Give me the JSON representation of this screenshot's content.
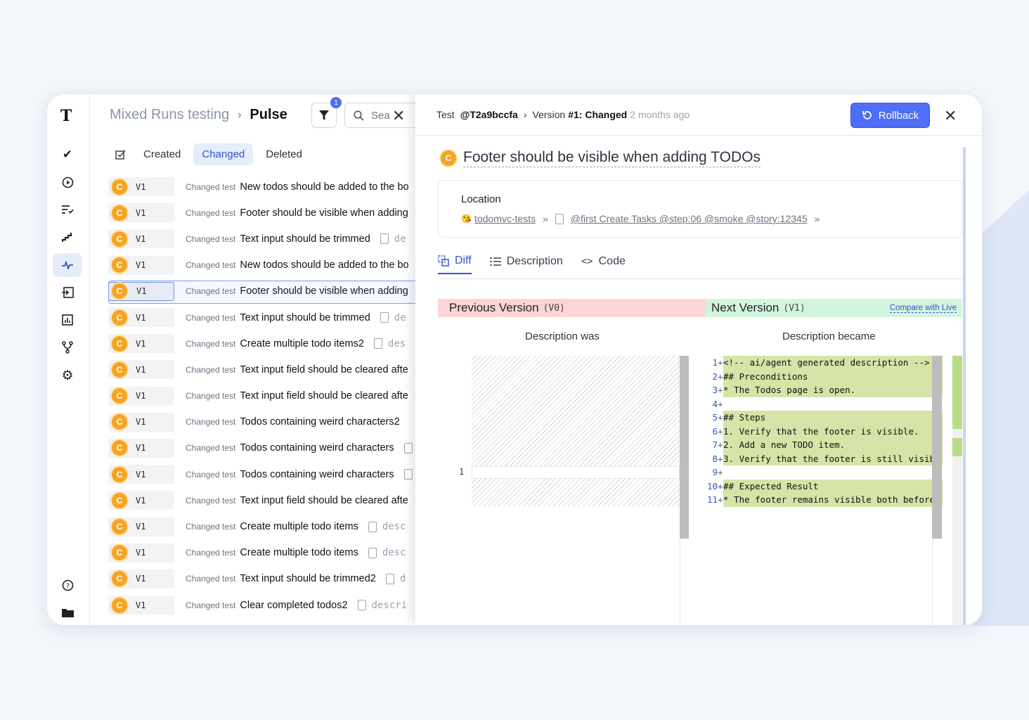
{
  "list": {
    "breadcrumb_parent": "Mixed Runs testing",
    "breadcrumb_current": "Pulse",
    "filter_badge": "1",
    "search_placeholder": "Sea",
    "tabs": [
      "Created",
      "Changed",
      "Deleted"
    ],
    "active_tab": "Changed",
    "rows": [
      {
        "version": "V1",
        "tag": "Changed test",
        "name": "New todos should be added to the bo",
        "desc": ""
      },
      {
        "version": "V1",
        "tag": "Changed test",
        "name": "Footer should be visible when adding",
        "desc": ""
      },
      {
        "version": "V1",
        "tag": "Changed test",
        "name": "Text input should be trimmed",
        "desc": "de"
      },
      {
        "version": "V1",
        "tag": "Changed test",
        "name": "New todos should be added to the bo",
        "desc": ""
      },
      {
        "version": "V1",
        "tag": "Changed test",
        "name": "Footer should be visible when adding",
        "desc": "",
        "selected": true
      },
      {
        "version": "V1",
        "tag": "Changed test",
        "name": "Text input should be trimmed",
        "desc": "de"
      },
      {
        "version": "V1",
        "tag": "Changed test",
        "name": "Create multiple todo items2",
        "desc": "des"
      },
      {
        "version": "V1",
        "tag": "Changed test",
        "name": "Text input field should be cleared afte",
        "desc": ""
      },
      {
        "version": "V1",
        "tag": "Changed test",
        "name": "Text input field should be cleared afte",
        "desc": ""
      },
      {
        "version": "V1",
        "tag": "Changed test",
        "name": "Todos containing weird characters2",
        "desc": ""
      },
      {
        "version": "V1",
        "tag": "Changed test",
        "name": "Todos containing weird characters",
        "desc": ""
      },
      {
        "version": "V1",
        "tag": "Changed test",
        "name": "Todos containing weird characters",
        "desc": ""
      },
      {
        "version": "V1",
        "tag": "Changed test",
        "name": "Text input field should be cleared afte",
        "desc": ""
      },
      {
        "version": "V1",
        "tag": "Changed test",
        "name": "Create multiple todo items",
        "desc": "desc"
      },
      {
        "version": "V1",
        "tag": "Changed test",
        "name": "Create multiple todo items",
        "desc": "desc"
      },
      {
        "version": "V1",
        "tag": "Changed test",
        "name": "Text input should be trimmed2",
        "desc": "d"
      },
      {
        "version": "V1",
        "tag": "Changed test",
        "name": "Clear completed todos2",
        "desc": "descri"
      }
    ]
  },
  "detail": {
    "test_label": "Test",
    "test_id": "@T2a9bccfa",
    "version_label": "Version",
    "version_value": "#1: Changed",
    "ago": "2 months ago",
    "rollback_label": "Rollback",
    "title": "Footer should be visible when adding TODOs",
    "location_label": "Location",
    "location_suite": "todomvc-tests",
    "location_tags": "@first Create Tasks @step:06 @smoke @story:12345",
    "tabs": [
      "Diff",
      "Description",
      "Code"
    ],
    "active_tab": "Diff",
    "prev_version_label": "Previous Version",
    "prev_version_code": "(V0)",
    "next_version_label": "Next Version",
    "next_version_code": "(V1)",
    "compare_live": "Compare with Live",
    "was_label": "Description was",
    "became_label": "Description became",
    "left_line_number": "1",
    "code_lines": [
      {
        "n": "1",
        "t": "<!-- ai/agent generated description -->",
        "added": true
      },
      {
        "n": "2",
        "t": "## Preconditions",
        "added": true
      },
      {
        "n": "3",
        "t": "* The Todos page is open.",
        "added": true
      },
      {
        "n": "4",
        "t": "",
        "added": false
      },
      {
        "n": "5",
        "t": "## Steps",
        "added": true
      },
      {
        "n": "6",
        "t": "1. Verify that the footer is visible.",
        "added": true
      },
      {
        "n": "7",
        "t": "2. Add a new TODO item.",
        "added": true
      },
      {
        "n": "8",
        "t": "3. Verify that the footer is still visibl",
        "added": true
      },
      {
        "n": "9",
        "t": "",
        "added": false
      },
      {
        "n": "10",
        "t": "## Expected Result",
        "added": true
      },
      {
        "n": "11",
        "t": "* The footer remains visible both before",
        "added": true
      }
    ]
  }
}
